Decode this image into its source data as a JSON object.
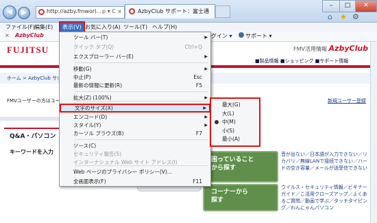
{
  "browser": {
    "address_url": "http://azby.fmworl...",
    "address_controls": "ρ ▾ C ×",
    "tab_title": "AzbyClub サポート：富士通",
    "window_buttons": [
      "–",
      "□",
      "✕"
    ]
  },
  "menubar": {
    "items": [
      "ファイル(F)",
      "編集(E)",
      "表示(V)",
      "お気に入り(A)",
      "ツール(T)",
      "ヘルプ(H)"
    ]
  },
  "toolbar": {
    "close": "×",
    "brand_prefix": "AzbyClub",
    "login": "グイン ▾",
    "support": "サポート ▾"
  },
  "page": {
    "logo": "FUJITSU",
    "brand_small": "FMV活用情報",
    "brand_big": "AzbyClub",
    "site_links": "■製品情報 ■ショッピング ■サポート情報",
    "breadcrumb": "ホーム > AzbyClub サポー",
    "info_left": "FMVユーザーの方はユー",
    "info_right": "新規ユーザー登録",
    "qa_title": "Q&A・パソコン",
    "keyword": "キーワードを入力",
    "panel1": "困っていること\nから探す",
    "panel2": "コーナーから\n探す",
    "right_text1": "音が出ない／日本語が入力できない／リカバリ／無線LANで接続できない／ハードの空き容量／メールが送受信できない",
    "right_text2": "ウイルス・セキュリティ情報／ビギナーガイド／こ活用クローズアップ／よくあるご質問／動画で学ぶ／タッチタイピング／わんにゃんパソコン"
  },
  "view_menu": {
    "items": [
      {
        "label": "ツール バー(T)",
        "shortcut": "",
        "arrow": "▶",
        "disabled": false
      },
      {
        "label": "クイック タブ(Q)",
        "shortcut": "Ctrl+Q",
        "arrow": "",
        "disabled": true
      },
      {
        "label": "エクスプローラー バー(E)",
        "shortcut": "",
        "arrow": "▶",
        "disabled": false
      },
      {
        "label": "移動(G)",
        "shortcut": "",
        "arrow": "▶",
        "disabled": false
      },
      {
        "label": "中止(P)",
        "shortcut": "Esc",
        "arrow": "",
        "disabled": false
      },
      {
        "label": "最新の情報に更新(R)",
        "shortcut": "F5",
        "arrow": "",
        "disabled": false
      },
      {
        "label": "拡大(Z) (100%)",
        "shortcut": "",
        "arrow": "▶",
        "disabled": false
      },
      {
        "label": "文字のサイズ(X)",
        "shortcut": "",
        "arrow": "▶",
        "disabled": false
      },
      {
        "label": "エンコード(D)",
        "shortcut": "",
        "arrow": "▶",
        "disabled": false
      },
      {
        "label": "スタイル(Y)",
        "shortcut": "",
        "arrow": "▶",
        "disabled": false
      },
      {
        "label": "カーソル ブラウズ(B)",
        "shortcut": "F7",
        "arrow": "",
        "disabled": false
      },
      {
        "label": "ソース(C)",
        "shortcut": "",
        "arrow": "",
        "disabled": false
      },
      {
        "label": "セキュリティ報告(S)",
        "shortcut": "",
        "arrow": "",
        "disabled": true
      },
      {
        "label": "インターナショナル Web サイト アドレス(I)",
        "shortcut": "",
        "arrow": "",
        "disabled": true
      },
      {
        "label": "Web ページのプライバシー ポリシー(V)...",
        "shortcut": "",
        "arrow": "",
        "disabled": false
      },
      {
        "label": "全画面表示(F)",
        "shortcut": "F11",
        "arrow": "",
        "disabled": false
      }
    ]
  },
  "text_size_submenu": {
    "items": [
      "最大(G)",
      "大(L)",
      "中(M)",
      "小(S)",
      "最小(A)"
    ],
    "selected": "中(M)"
  }
}
